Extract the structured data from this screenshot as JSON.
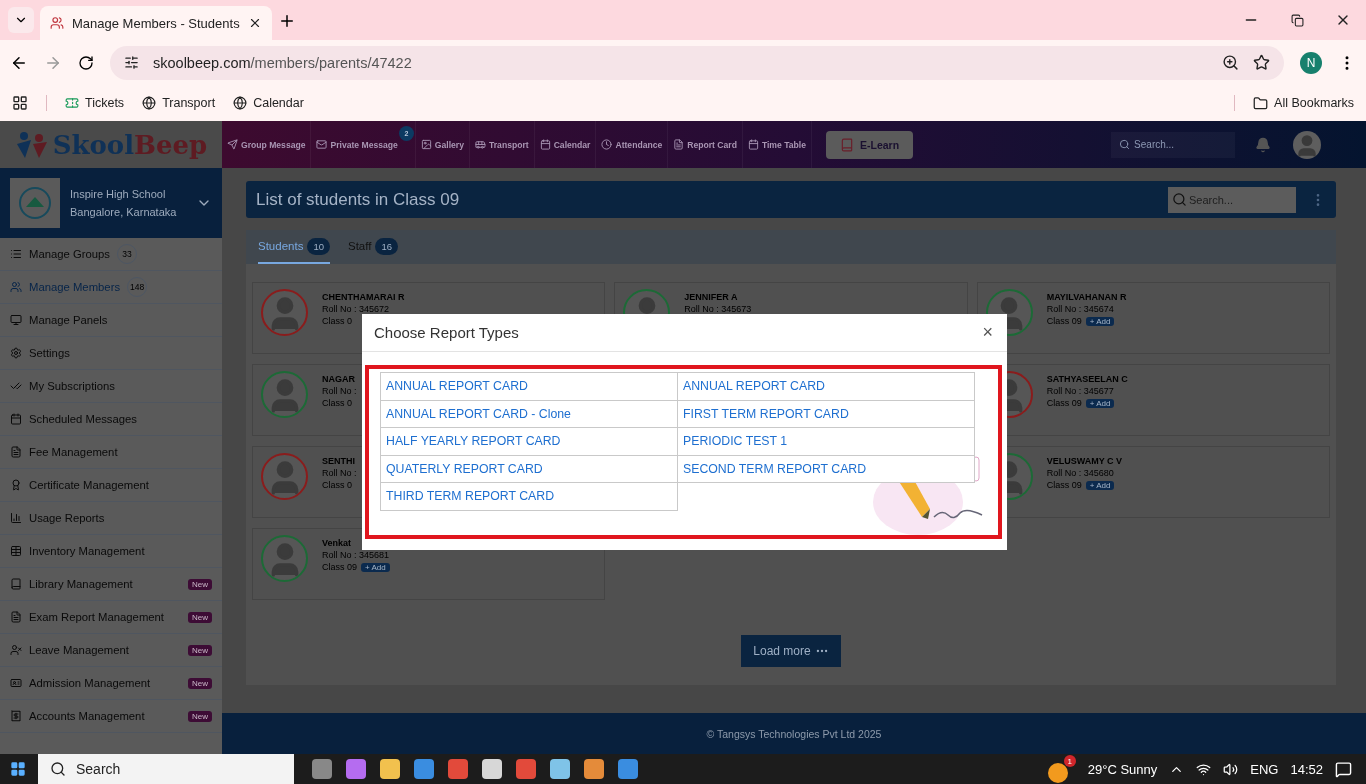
{
  "browser": {
    "tab_title": "Manage Members - Students",
    "address_host": "skoolbeep.com",
    "address_path": "/members/parents/47422",
    "bookmarks": [
      "Tickets",
      "Transport",
      "Calendar"
    ],
    "all_bookmarks": "All Bookmarks",
    "profile": "N"
  },
  "app": {
    "logo_first": "Skool",
    "logo_second": "Beep",
    "nav": [
      {
        "label": "Group Message"
      },
      {
        "label": "Private Message",
        "badge": "2"
      },
      {
        "label": "Gallery"
      },
      {
        "label": "Transport"
      },
      {
        "label": "Calendar"
      },
      {
        "label": "Attendance"
      },
      {
        "label": "Report Card"
      },
      {
        "label": "Time Table"
      }
    ],
    "elearn": "E-Learn",
    "search_placeholder": "Search...",
    "school": {
      "name": "Inspire High School",
      "location": "Bangalore, Karnataka"
    },
    "sidebar": [
      {
        "label": "Manage Groups",
        "count": "33",
        "selected": false
      },
      {
        "label": "Manage Members",
        "count": "148",
        "selected": true
      },
      {
        "label": "Manage Panels",
        "selected": false
      },
      {
        "label": "Settings",
        "selected": false
      },
      {
        "label": "My Subscriptions",
        "selected": false
      },
      {
        "label": "Scheduled Messages",
        "selected": false
      },
      {
        "label": "Fee Management",
        "selected": false
      },
      {
        "label": "Certificate Management",
        "selected": false
      },
      {
        "label": "Usage Reports",
        "selected": false
      },
      {
        "label": "Inventory Management",
        "selected": false
      },
      {
        "label": "Library Management",
        "tag": "New",
        "selected": false
      },
      {
        "label": "Exam Report Management",
        "tag": "New",
        "selected": false
      },
      {
        "label": "Leave Management",
        "tag": "New",
        "selected": false
      },
      {
        "label": "Admission Management",
        "tag": "New",
        "selected": false
      },
      {
        "label": "Accounts Management",
        "tag": "New",
        "selected": false
      }
    ],
    "list_title": "List of students in Class 09",
    "list_search_placeholder": "Search...",
    "tabs": [
      {
        "label": "Students",
        "count": "10",
        "selected": true
      },
      {
        "label": "Staff",
        "count": "16",
        "selected": false
      }
    ],
    "student_columns": [
      [
        {
          "name": "CHENTHAMARAI R",
          "roll": "Roll No : 345672",
          "class": "Class 0",
          "color": "#8a1c1c"
        },
        {
          "name": "NAGAR",
          "roll": "Roll No :",
          "class": "Class 0",
          "color": "#1c6a36"
        },
        {
          "name": "SENTHI",
          "roll": "Roll No :",
          "class": "Class 0",
          "color": "#8a1c1c"
        },
        {
          "name": "Venkat",
          "roll": "Roll No : 345681",
          "class": "Class 09",
          "add": "+ Add",
          "color": "#1c6a36"
        }
      ],
      [
        {
          "name": "JENNIFER A",
          "roll": "Roll No : 345673",
          "color": "#1c6a36"
        }
      ],
      [
        {
          "name": "MAYILVAHANAN R",
          "roll": "Roll No : 345674",
          "class": "Class 09",
          "add": "+ Add",
          "color": "#1c6a36"
        },
        {
          "name": "SATHYASEELAN C",
          "roll": "Roll No : 345677",
          "class": "Class 09",
          "add": "+ Add",
          "color": "#8a1c1c"
        },
        {
          "name": "VELUSWAMY C V",
          "roll": "Roll No : 345680",
          "class": "Class 09",
          "add": "+ Add",
          "color": "#1c6a36"
        }
      ]
    ],
    "load_more": "Load more",
    "footer": "© Tangsys Technologies Pvt Ltd 2025"
  },
  "dialog": {
    "title": "Choose Report Types",
    "close": "×",
    "options": [
      "ANNUAL REPORT CARD",
      "ANNUAL REPORT CARD",
      "ANNUAL REPORT CARD - Clone",
      "FIRST TERM REPORT CARD",
      "HALF YEARLY REPORT CARD",
      "PERIODIC TEST 1",
      "QUATERLY REPORT CARD",
      "SECOND TERM REPORT CARD",
      "THIRD TERM REPORT CARD"
    ]
  },
  "taskbar": {
    "search": "Search",
    "weather": "29°C Sunny",
    "weather_badge": "1",
    "language": "ENG",
    "time": "14:52"
  }
}
